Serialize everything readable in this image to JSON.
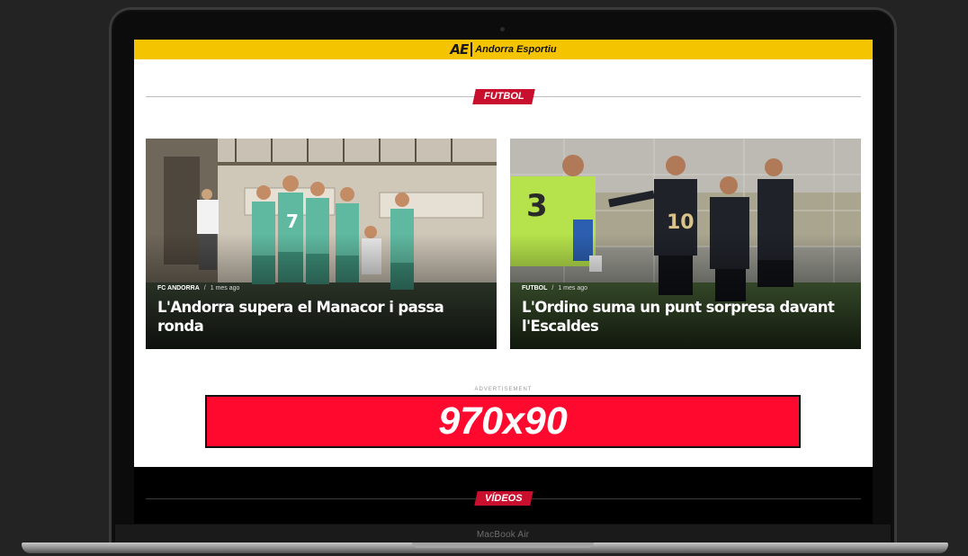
{
  "site": {
    "logo_mark": "AE",
    "name": "Andorra Esportiu"
  },
  "sections": {
    "futbol": "FUTBOL",
    "videos": "VÍDEOS"
  },
  "articles": [
    {
      "category": "FC ANDORRA",
      "separator": "/",
      "time": "1 mes ago",
      "headline": "L'Andorra supera el Manacor i passa ronda"
    },
    {
      "category": "FUTBOL",
      "separator": "/",
      "time": "1 mes ago",
      "headline": "L'Ordino suma un punt sorpresa davant l'Escaldes"
    }
  ],
  "ad": {
    "label": "ADVERTISEMENT",
    "text": "970x90"
  },
  "device": {
    "label": "MacBook Air"
  },
  "colors": {
    "header_yellow": "#f5c400",
    "badge_red": "#c8102e",
    "ad_red": "#ff0a2e",
    "team_green": "#5fb9a0",
    "keeper_green": "#b6e34b"
  }
}
